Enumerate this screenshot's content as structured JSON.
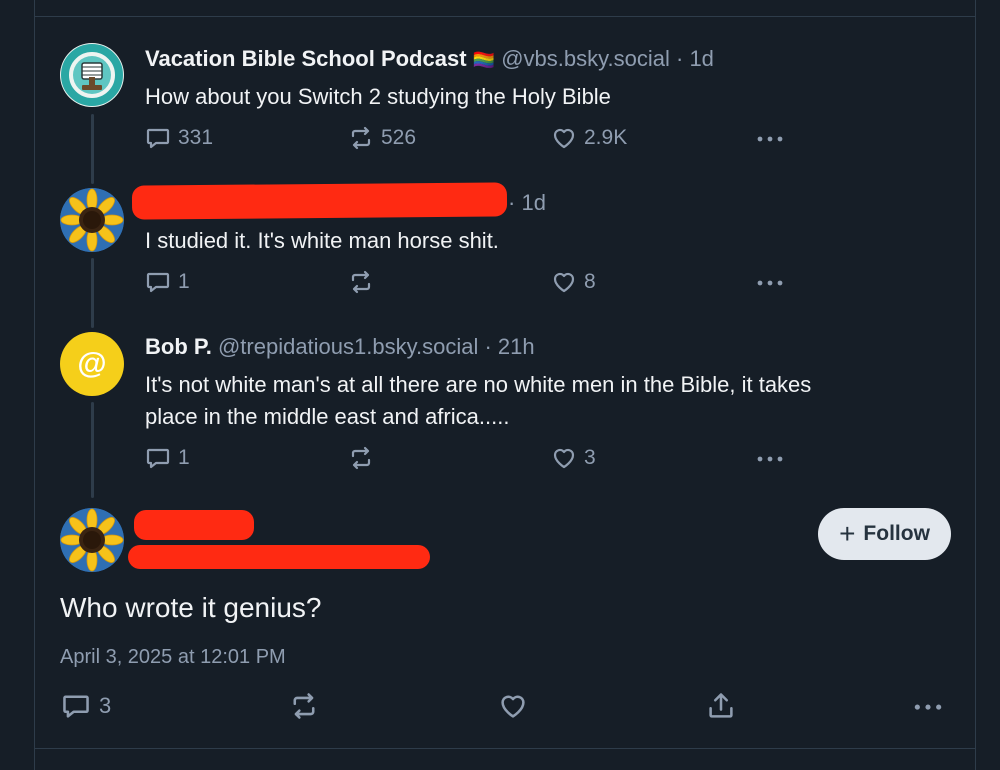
{
  "posts": [
    {
      "name": "Vacation Bible School Podcast",
      "flag": "🏳️‍🌈",
      "handle": "@vbs.bsky.social",
      "time": "1d",
      "text": "How about you Switch 2 studying the Holy Bible",
      "replies": "331",
      "reposts": "526",
      "likes": "2.9K"
    },
    {
      "time": "1d",
      "text": "I studied it. It's white man horse shit.",
      "replies": "1",
      "reposts": "",
      "likes": "8"
    },
    {
      "name": "Bob P.",
      "handle": "@trepidatious1.bsky.social",
      "time": "21h",
      "avatar_glyph": "@",
      "text_line1": "It's not white man's at all there are no white men in the Bible, it takes",
      "text_line2": "place in the middle east and africa.....",
      "replies": "1",
      "reposts": "",
      "likes": "3"
    }
  ],
  "main_post": {
    "follow_label": "Follow",
    "follow_plus": "+",
    "text": "Who wrote it genius?",
    "timestamp": "April 3, 2025 at 12:01 PM",
    "replies": "3"
  },
  "icons": [
    "reply-icon",
    "repost-icon",
    "like-icon",
    "more-icon",
    "share-icon",
    "plus-icon"
  ],
  "colors": {
    "background": "#161e27",
    "muted": "#8f9db0",
    "redaction": "#ff2a12",
    "follow_bg": "#e3e8ee"
  }
}
